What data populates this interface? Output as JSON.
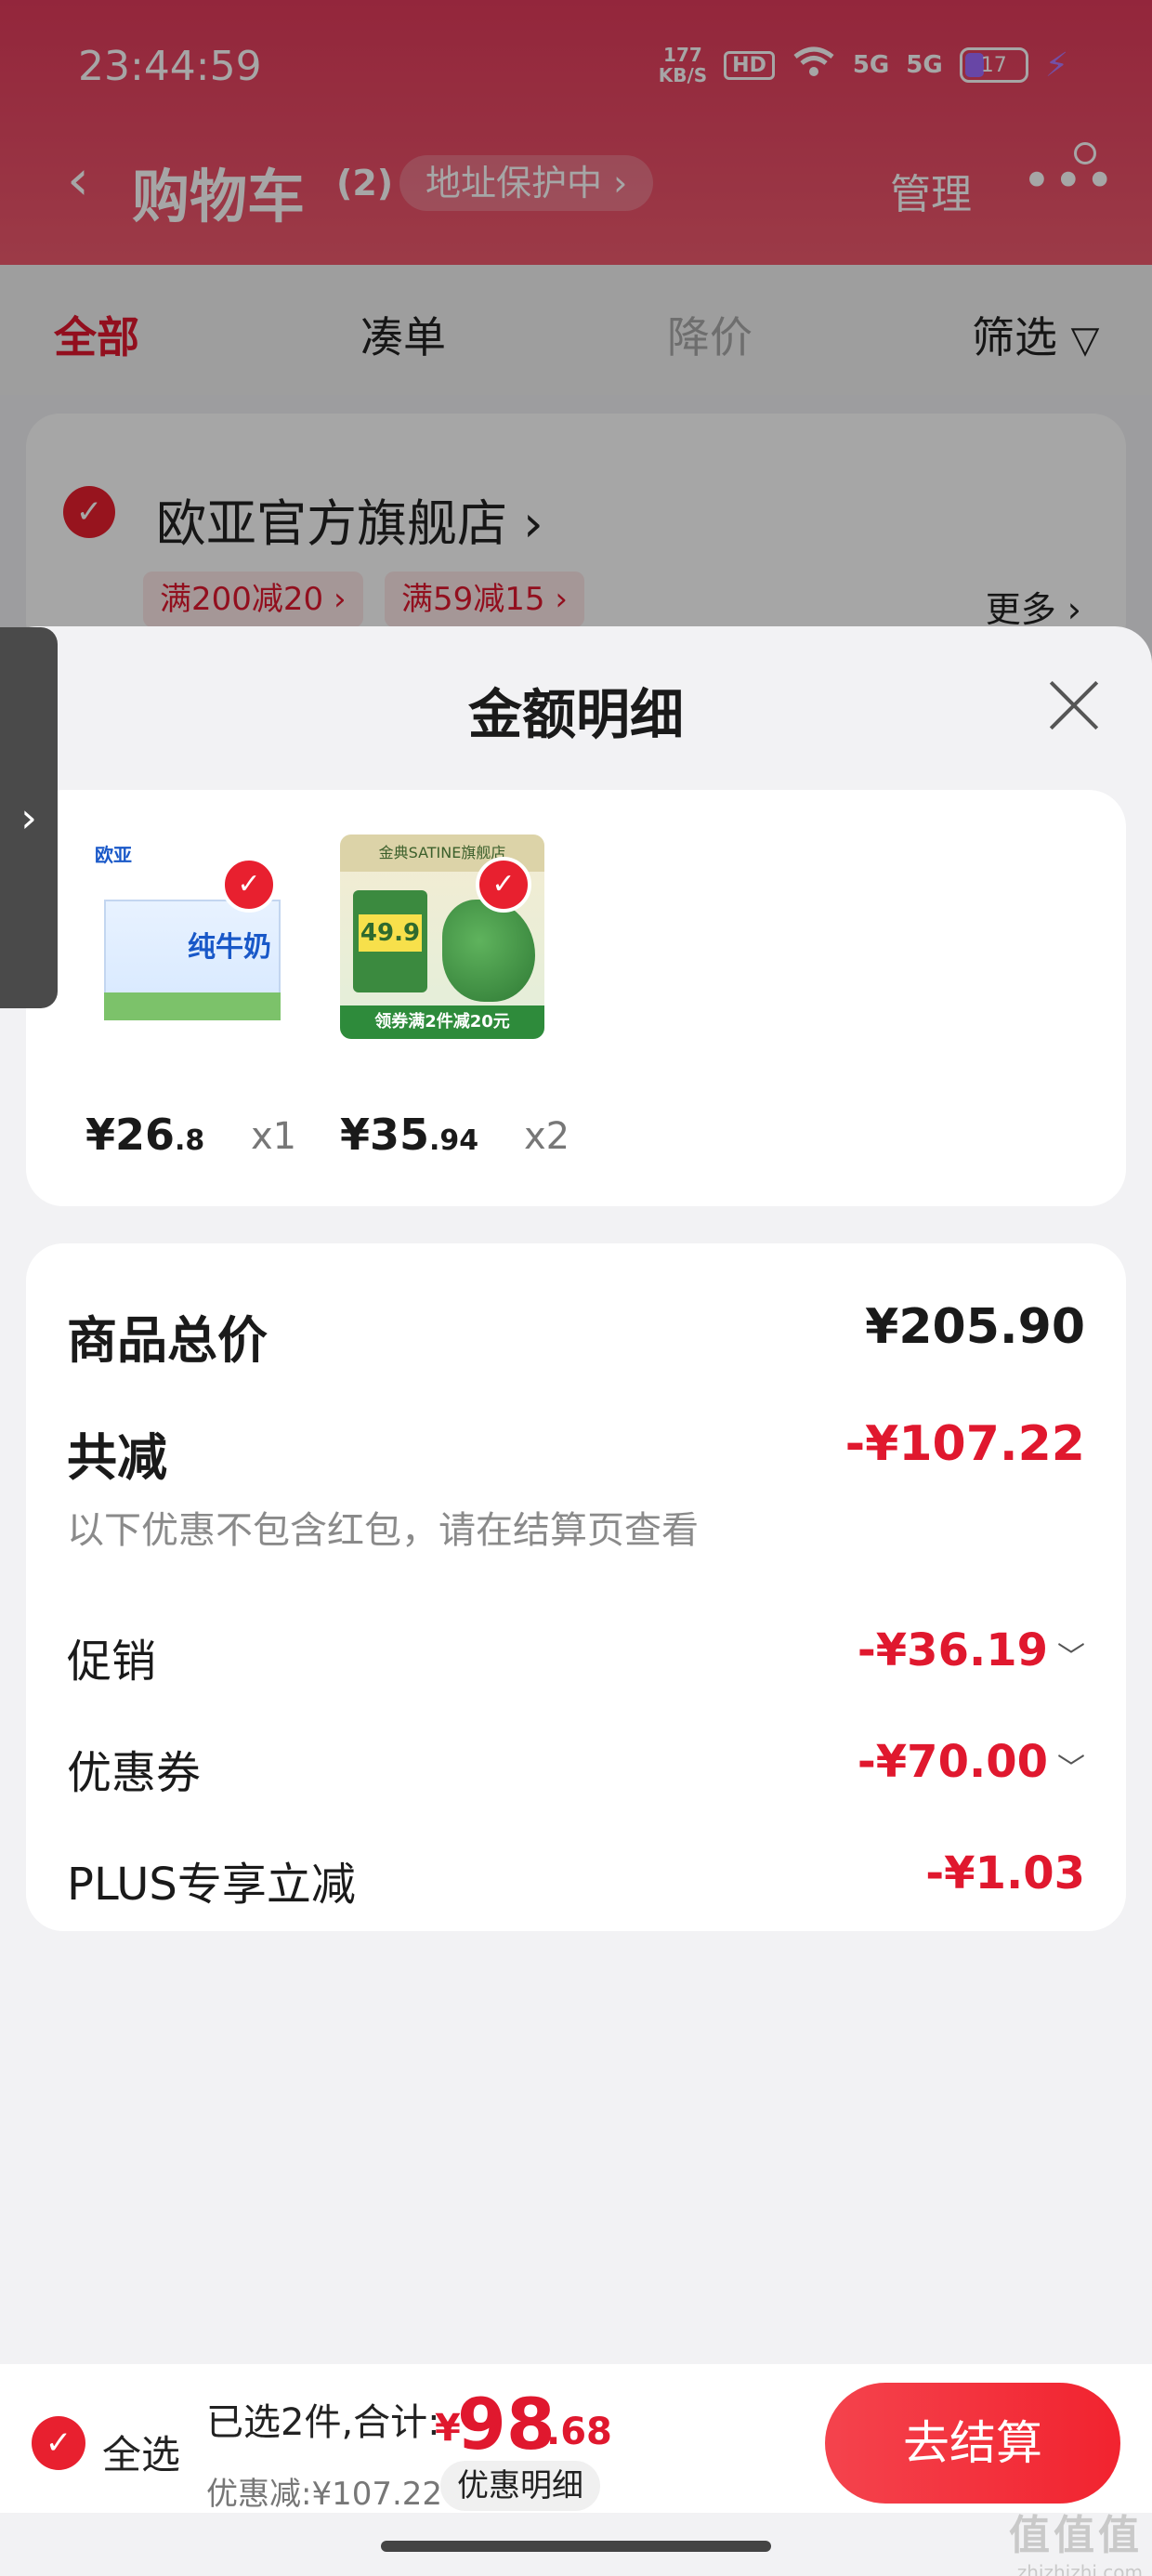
{
  "status_bar": {
    "time": "23:44:59",
    "speed_value": "177",
    "speed_unit": "KB/S",
    "hd": "HD",
    "signal_1": "5G",
    "signal_2": "5G",
    "battery": "17"
  },
  "header": {
    "title": "购物车",
    "count": "(2)",
    "address_protection": "地址保护中 ›",
    "manage": "管理"
  },
  "tabs": [
    {
      "label": "全部"
    },
    {
      "label": "凑单"
    },
    {
      "label": "降价"
    },
    {
      "label": "筛选"
    }
  ],
  "store": {
    "name": "欧亚官方旗舰店 ›",
    "promos": [
      "满200减20 ›",
      "满59减15 ›"
    ],
    "more": "更多 ›"
  },
  "sheet": {
    "title": "金额明细",
    "products": [
      {
        "image_text": "纯牛奶",
        "image_logo": "欧亚",
        "price_int": "¥26",
        "price_dec": ".8",
        "qty": "x1"
      },
      {
        "image_text": "49.9",
        "image_banner": "领券满2件减20元",
        "image_top": "金典SATINE旗舰店",
        "price_int": "¥35",
        "price_dec": ".94",
        "qty": "x2"
      }
    ],
    "summary": {
      "goods_total_label": "商品总价",
      "goods_total_value": "¥205.90",
      "total_reduce_label": "共减",
      "total_reduce_value": "-¥107.22",
      "note": "以下优惠不包含红包，请在结算页查看",
      "promo_label": "促销",
      "promo_value": "-¥36.19",
      "coupon_label": "优惠券",
      "coupon_value": "-¥70.00",
      "plus_label": "PLUS专享立减",
      "plus_value": "-¥1.03"
    }
  },
  "bottom_bar": {
    "select_all": "全选",
    "selected_info": "已选2件,合计:",
    "total_yen": "¥",
    "total_int": "98",
    "total_dec": ".68",
    "discount": "优惠减:¥107.22",
    "detail_button": "优惠明细",
    "checkout": "去结算"
  },
  "watermark": {
    "line1": "值值值",
    "line2": "zhizhizhi.com"
  },
  "colors": {
    "brand_red": "#e0182e",
    "header_gradient_top": "#e23b5c",
    "checkout_red": "#f2232f"
  }
}
